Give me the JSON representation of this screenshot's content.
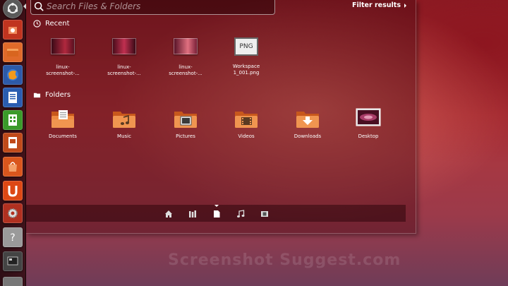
{
  "search": {
    "placeholder": "Search Files & Folders",
    "value": ""
  },
  "filter_label": "Filter results",
  "recent": {
    "title": "Recent",
    "items": [
      {
        "label": "linux-\nscreenshot-...",
        "kind": "screenshot"
      },
      {
        "label": "linux-\nscreenshot-...",
        "kind": "screenshot"
      },
      {
        "label": "linux-\nscreenshot-...",
        "kind": "screenshot"
      },
      {
        "label": "Workspace\n1_001.png",
        "kind": "png",
        "badge": "PNG"
      }
    ]
  },
  "folders": {
    "title": "Folders",
    "items": [
      {
        "label": "Documents",
        "icon": "documents-folder-icon"
      },
      {
        "label": "Music",
        "icon": "music-folder-icon"
      },
      {
        "label": "Pictures",
        "icon": "pictures-folder-icon"
      },
      {
        "label": "Videos",
        "icon": "videos-folder-icon"
      },
      {
        "label": "Downloads",
        "icon": "downloads-folder-icon"
      },
      {
        "label": "Desktop",
        "icon": "desktop-icon"
      }
    ]
  },
  "lenses": [
    "home-lens-icon",
    "applications-lens-icon",
    "files-lens-icon",
    "music-lens-icon",
    "video-lens-icon"
  ],
  "active_lens": "files-lens-icon",
  "launcher": [
    "dash-home-icon",
    "software-center-icon",
    "home-folder-icon",
    "firefox-icon",
    "writer-icon",
    "calc-icon",
    "impress-icon",
    "ubuntu-software-icon",
    "ubuntu-one-icon",
    "system-settings-icon",
    "help-icon",
    "workspace-switcher-icon",
    "trash-icon"
  ],
  "watermark": "Screenshot Suggest.com",
  "colors": {
    "folder": "#e8823c",
    "accent": "#dd4814"
  }
}
